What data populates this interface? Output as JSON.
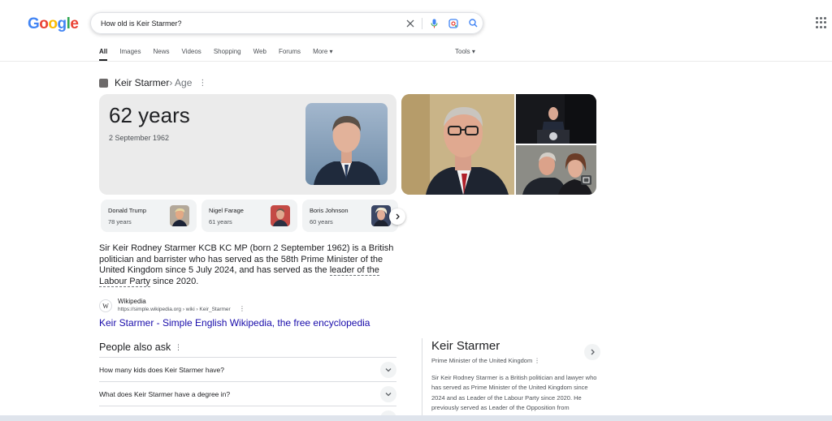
{
  "header": {
    "logo_letters": [
      {
        "ch": "G",
        "color": "#4285f4"
      },
      {
        "ch": "o",
        "color": "#ea4335"
      },
      {
        "ch": "o",
        "color": "#fbbc05"
      },
      {
        "ch": "g",
        "color": "#4285f4"
      },
      {
        "ch": "l",
        "color": "#34a853"
      },
      {
        "ch": "e",
        "color": "#ea4335"
      }
    ],
    "query": "How old is Keir Starmer?",
    "icons": [
      "close-icon",
      "microphone-icon",
      "lens-icon",
      "search-icon",
      "apps-icon"
    ]
  },
  "tabs": {
    "items": [
      "All",
      "Images",
      "News",
      "Videos",
      "Shopping",
      "Web",
      "Forums",
      "More ▾"
    ],
    "active": "All",
    "tools": "Tools ▾"
  },
  "kp": {
    "name": "Keir Starmer",
    "attribute": " › Age",
    "age": "62 years",
    "dob": "2 September 1962"
  },
  "people": [
    {
      "name": "Donald Trump",
      "age": "78 years"
    },
    {
      "name": "Nigel Farage",
      "age": "61 years"
    },
    {
      "name": "Boris Johnson",
      "age": "60 years"
    }
  ],
  "description": {
    "part1": "Sir Keir Rodney Starmer KCB KC MP (born 2 September 1962) is a British politician and barrister who has served as the 58th Prime Minister of the United Kingdom since 5 July 2024, and has served as the ",
    "link": "leader of the Labour Party",
    "part2": " since 2020."
  },
  "source": {
    "favicon": "W",
    "name": "Wikipedia",
    "url": "https://simple.wikipedia.org › wiki › Keir_Starmer",
    "title": "Keir Starmer - Simple English Wikipedia, the free encyclopedia"
  },
  "paa": {
    "title": "People also ask",
    "questions": [
      "How many kids does Keir Starmer have?",
      "What does Keir Starmer have a degree in?"
    ]
  },
  "panel": {
    "title": "Keir Starmer",
    "subtitle": "Prime Minister of the United Kingdom",
    "description": "Sir Keir Rodney Starmer is a British politician and lawyer who has served as Prime Minister of the United Kingdom since 2024 and as Leader of the Labour Party since 2020. He previously served as Leader of the Opposition from"
  }
}
